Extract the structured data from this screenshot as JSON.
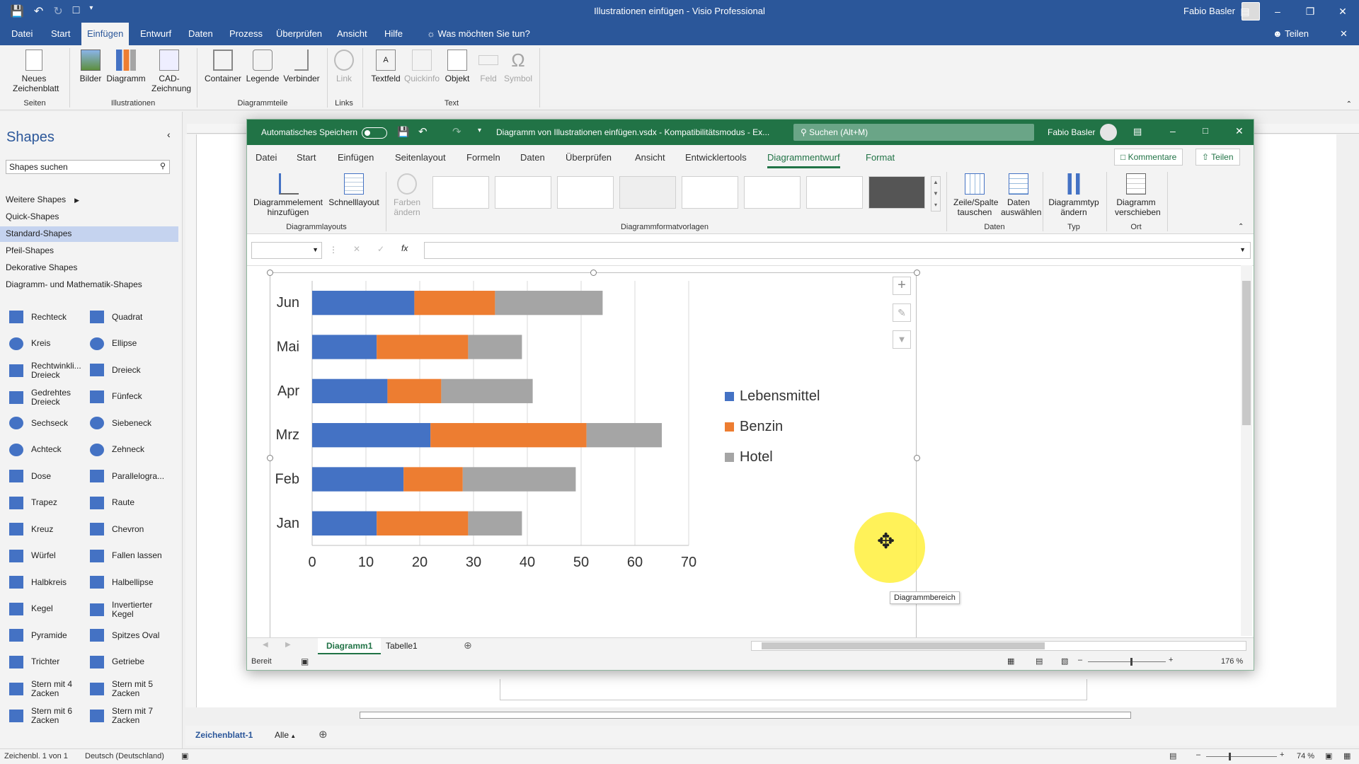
{
  "visio": {
    "title": "Illustrationen einfügen  -  Visio Professional",
    "user": "Fabio Basler",
    "share": "Teilen",
    "tell_me": "Was möchten Sie tun?",
    "tabs": [
      "Datei",
      "Start",
      "Einfügen",
      "Entwurf",
      "Daten",
      "Prozess",
      "Überprüfen",
      "Ansicht",
      "Hilfe"
    ],
    "ribbon": {
      "new_sheet": "Neues Zeichenblatt",
      "pictures": "Bilder",
      "diagram": "Diagramm",
      "cad": "CAD-Zeichnung",
      "container": "Container",
      "legend": "Legende",
      "connector": "Verbinder",
      "link": "Link",
      "textfield": "Textfeld",
      "quickinfo": "Quickinfo",
      "object": "Objekt",
      "field": "Feld",
      "symbol": "Symbol",
      "groups": [
        "Seiten",
        "Illustrationen",
        "Diagrammteile",
        "Links",
        "Text"
      ]
    },
    "shapes_pane": {
      "title": "Shapes",
      "search_placeholder": "Shapes suchen",
      "stencils": [
        "Weitere Shapes",
        "Quick-Shapes",
        "Standard-Shapes",
        "Pfeil-Shapes",
        "Dekorative Shapes",
        "Diagramm- und Mathematik-Shapes"
      ],
      "items": [
        [
          "Rechteck",
          "Quadrat"
        ],
        [
          "Kreis",
          "Ellipse"
        ],
        [
          "Rechtwinkli... Dreieck",
          "Dreieck"
        ],
        [
          "Gedrehtes Dreieck",
          "Fünfeck"
        ],
        [
          "Sechseck",
          "Siebeneck"
        ],
        [
          "Achteck",
          "Zehneck"
        ],
        [
          "Dose",
          "Parallelogra..."
        ],
        [
          "Trapez",
          "Raute"
        ],
        [
          "Kreuz",
          "Chevron"
        ],
        [
          "Würfel",
          "Fallen lassen"
        ],
        [
          "Halbkreis",
          "Halbellipse"
        ],
        [
          "Kegel",
          "Invertierter Kegel"
        ],
        [
          "Pyramide",
          "Spitzes Oval"
        ],
        [
          "Trichter",
          "Getriebe"
        ],
        [
          "Stern mit 4 Zacken",
          "Stern mit 5 Zacken"
        ],
        [
          "Stern mit 6 Zacken",
          "Stern mit 7 Zacken"
        ]
      ]
    },
    "page_tab": "Zeichenblatt-1",
    "all_tab": "Alle",
    "status": {
      "page": "Zeichenbl. 1 von 1",
      "lang": "Deutsch (Deutschland)",
      "zoom": "74 %"
    }
  },
  "excel": {
    "autosave": "Automatisches Speichern",
    "file": "Diagramm von Illustrationen einfügen.vsdx  -  Kompatibilitätsmodus  -  Ex...",
    "search": "Suchen (Alt+M)",
    "user": "Fabio Basler",
    "tabs": [
      "Datei",
      "Start",
      "Einfügen",
      "Seitenlayout",
      "Formeln",
      "Daten",
      "Überprüfen",
      "Ansicht",
      "Entwicklertools",
      "Diagrammentwurf",
      "Format"
    ],
    "comments": "Kommentare",
    "share": "Teilen",
    "ribbon": {
      "add_element": "Diagrammelement hinzufügen",
      "quick_layout": "Schnelllayout",
      "colors": "Farben ändern",
      "switch": "Zeile/Spalte tauschen",
      "select_data": "Daten auswählen",
      "change_type": "Diagrammtyp ändern",
      "move_chart": "Diagramm verschieben",
      "groups": [
        "Diagrammlayouts",
        "Diagrammformatvorlagen",
        "Daten",
        "Typ",
        "Ort"
      ]
    },
    "sheets": [
      "Diagramm1",
      "Tabelle1"
    ],
    "status": "Bereit",
    "zoom": "176 %",
    "tooltip": "Diagrammbereich"
  },
  "chart_data": {
    "type": "bar",
    "orientation": "horizontal",
    "stacked": true,
    "categories": [
      "Jan",
      "Feb",
      "Mrz",
      "Apr",
      "Mai",
      "Jun"
    ],
    "series": [
      {
        "name": "Lebensmittel",
        "color": "#4472c4",
        "values": [
          12,
          17,
          22,
          14,
          12,
          19
        ]
      },
      {
        "name": "Benzin",
        "color": "#ed7d31",
        "values": [
          17,
          11,
          29,
          10,
          17,
          15
        ]
      },
      {
        "name": "Hotel",
        "color": "#a5a5a5",
        "values": [
          10,
          21,
          14,
          17,
          10,
          20
        ]
      }
    ],
    "xlim": [
      0,
      70
    ],
    "xticks": [
      0,
      10,
      20,
      30,
      40,
      50,
      60,
      70
    ],
    "grid": true,
    "legend": "right"
  }
}
